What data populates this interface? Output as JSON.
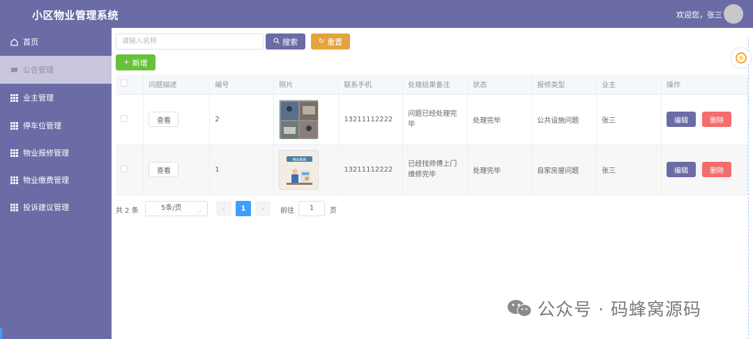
{
  "header": {
    "title": "小区物业管理系统",
    "welcome": "欢迎您，张三"
  },
  "sidebar": {
    "items": [
      {
        "label": "首页",
        "icon": "home-icon"
      },
      {
        "label": "公告管理",
        "icon": "notice-icon",
        "active": true
      },
      {
        "label": "业主管理",
        "icon": "grid-icon"
      },
      {
        "label": "停车位管理",
        "icon": "grid-icon"
      },
      {
        "label": "物业报修管理",
        "icon": "grid-icon"
      },
      {
        "label": "物业缴费管理",
        "icon": "grid-icon"
      },
      {
        "label": "投诉建议管理",
        "icon": "grid-icon"
      }
    ]
  },
  "toolbar": {
    "search_placeholder": "请输入名称",
    "search_label": "搜索",
    "reset_label": "重置",
    "add_label": "新增"
  },
  "table": {
    "columns": [
      "问题描述",
      "编号",
      "照片",
      "联系手机",
      "处理结果备注",
      "状态",
      "报修类型",
      "业主",
      "操作"
    ],
    "rows": [
      {
        "description_btn": "查看",
        "id": "2",
        "phone": "13211112222",
        "remark": "问题已经处理完毕",
        "status": "处理完毕",
        "type": "公共设施问题",
        "owner": "张三",
        "edit": "编辑",
        "delete": "删除"
      },
      {
        "description_btn": "查看",
        "id": "1",
        "phone": "13211112222",
        "remark": "已经找师傅上门维修完毕",
        "status": "处理完毕",
        "type": "自家房屋问题",
        "owner": "张三",
        "edit": "编辑",
        "delete": "删除"
      }
    ]
  },
  "pagination": {
    "total": "共 2 条",
    "page_size": "5条/页",
    "current_page": "1",
    "goto_label": "前往",
    "goto_value": "1",
    "goto_unit": "页"
  },
  "photo2_caption": "物业报修",
  "watermark": "公众号 · 码蜂窝源码",
  "colors": {
    "header_bg": "#6b6ba6",
    "sidebar_active": "#c9c7dd",
    "search_btn": "#6b6ba6",
    "reset_btn": "#e6a23c",
    "add_btn": "#67c23a",
    "edit_btn": "#6b6ba6",
    "delete_btn": "#f56c6c",
    "page_active": "#409eff"
  }
}
